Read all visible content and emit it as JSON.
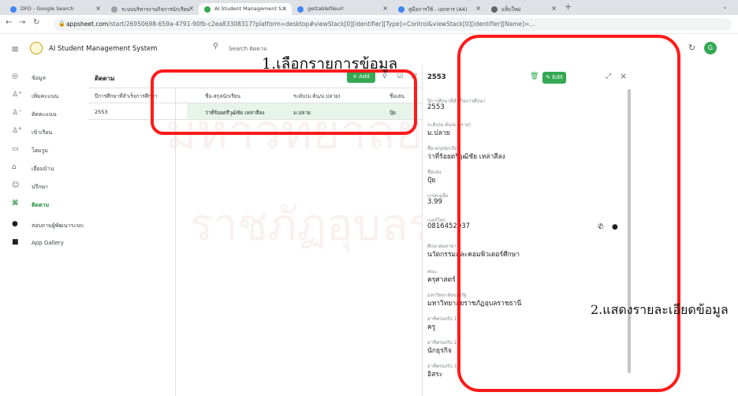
{
  "browser": {
    "tabs": [
      {
        "label": "DFD - Google Search",
        "color": "#4285f4"
      },
      {
        "label": "ระบบบริหารงานกิจการนักเรียน",
        "color": "#9aa0a6"
      },
      {
        "label": "AI Student Management S...",
        "color": "#34a853"
      },
      {
        "label": "gettablefileurl",
        "color": "#4285f4"
      },
      {
        "label": "คู่มือการใช้ - เอกสาร (A4)",
        "color": "#4285f4"
      },
      {
        "label": "แท็บใหม่",
        "color": "#5f6368"
      }
    ],
    "url_domain": "appsheet.com",
    "url_path": "/start/26950698-659a-4791-90fb-c2ea83308317?platform=desktop#viewStack[0][identifier][Type]=Control&viewStack[0][identifier][Name]=..."
  },
  "app": {
    "title": "AI Student Management System",
    "search_placeholder": "Search ติดตาม",
    "avatar_letter": "G"
  },
  "sidebar": {
    "items": [
      {
        "label": "ข้อมูล",
        "icon": "◎"
      },
      {
        "label": "เพิ่มคะแนน",
        "icon": "⁺"
      },
      {
        "label": "ตัดคะแนน",
        "icon": "⁻"
      },
      {
        "label": "เข้าเรียน",
        "icon": "⚇"
      },
      {
        "label": "โฮมรูม",
        "icon": "▭"
      },
      {
        "label": "เยี่ยมบ้าน",
        "icon": "⌂"
      },
      {
        "label": "ปรึกษา",
        "icon": "☺"
      },
      {
        "label": "ติดตาม",
        "icon": "⌘"
      },
      {
        "label": "สอบถามผู้พัฒนาระบบ",
        "icon": "●"
      },
      {
        "label": "App Gallery",
        "icon": "■"
      }
    ]
  },
  "table": {
    "title": "ติดตาม",
    "add_label": "+ Add",
    "columns": [
      "ปีการศึกษาที่สำเร็จการศึกษา",
      "ชื่อ-สกุลนักเรียน",
      "ระดับ(ม.ต้น/ม.ปลาย)",
      "ชื่อเล่น"
    ],
    "rows": [
      [
        "2553",
        "ว่าที่ร้อยตรีวุฒิชัย เหล่าสีลง",
        "ม.ปลาย",
        "ปุ้ย"
      ]
    ]
  },
  "detail": {
    "header": "2553",
    "edit_label": "Edit",
    "fields": [
      {
        "label": "ปีการศึกษาที่สำเร็จการศึกษา",
        "value": "2553"
      },
      {
        "label": "ระดับ(ม.ต้น/ม.ปลาย)",
        "value": "ม.ปลาย"
      },
      {
        "label": "ชื่อ-สกุลนักเรียน",
        "value": "ว่าที่ร้อยตรีวุฒิชัย เหล่าสีลง"
      },
      {
        "label": "ชื่อเล่น",
        "value": "ปุ้ย"
      },
      {
        "label": "เกรดเฉลี่ย",
        "value": "3.99"
      },
      {
        "label": "เบอร์โทร",
        "value": "0816452937"
      },
      {
        "label": "ศึกษาต่อสาขา",
        "value": "นวัตกรรมและคอมพิวเตอร์ศึกษา"
      },
      {
        "label": "คณะ",
        "value": "ครุศาสตร์"
      },
      {
        "label": "มหาวิทยาลัยของรัฐ",
        "value": "มหาวิทยาลัยราชภัฏอุบลราชธานี"
      },
      {
        "label": "อาชีพรองรับ 1",
        "value": "ครู"
      },
      {
        "label": "อาชีพรองรับ 2",
        "value": "นักธุรกิจ"
      },
      {
        "label": "อาชีพรองรับ 3",
        "value": "อิสระ"
      }
    ]
  },
  "annotations": {
    "label1": "1.เลือกรายการข้อมูล",
    "label2": "2.แสดงรายละเอียดข้อมูล",
    "color": "#ff1a1a"
  }
}
